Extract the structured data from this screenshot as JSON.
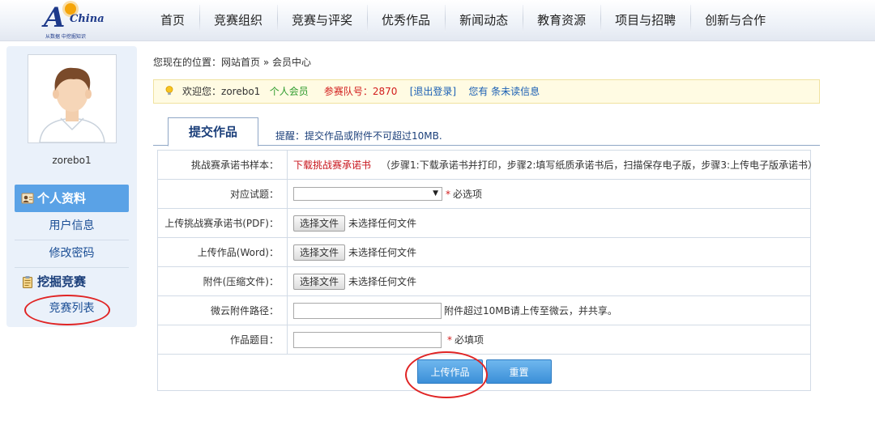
{
  "header": {
    "logo": {
      "letter": "A",
      "brand": "China",
      "tagline": "从数据   中挖掘知识"
    },
    "nav": [
      "首页",
      "竞赛组织",
      "竞赛与评奖",
      "优秀作品",
      "新闻动态",
      "教育资源",
      "项目与招聘",
      "创新与合作"
    ]
  },
  "sidebar": {
    "username": "zorebo1",
    "profile_heading": "个人资料",
    "items": [
      "用户信息",
      "修改密码"
    ],
    "contest_heading": "挖掘竞赛",
    "contest_items": [
      "竞赛列表"
    ]
  },
  "breadcrumb": {
    "prefix": "您现在的位置：",
    "home": "网站首页",
    "sep": " » ",
    "current": "会员中心"
  },
  "welcome": {
    "greeting": "欢迎您：",
    "user": "zorebo1",
    "member_type": "个人会员",
    "team_label": "参赛队号：",
    "team_id": "2870",
    "logout": "[退出登录]",
    "messages": "您有 条未读信息"
  },
  "tab": {
    "label": "提交作品",
    "tip": "提醒：提交作品或附件不可超过10MB."
  },
  "form": {
    "rows": [
      {
        "label": "挑战赛承诺书样本：",
        "link": "下载挑战赛承诺书",
        "note": "（步骤1:下载承诺书并打印，步骤2:填写纸质承诺书后，扫描保存电子版，步骤3:上传电子版承诺书）"
      },
      {
        "label": "对应试题：",
        "required_mark": "*",
        "hint": "必选项"
      },
      {
        "label": "上传挑战赛承诺书(PDF)：",
        "button": "选择文件",
        "status": "未选择任何文件"
      },
      {
        "label": "上传作品(Word)：",
        "button": "选择文件",
        "status": "未选择任何文件"
      },
      {
        "label": "附件(压缩文件)：",
        "button": "选择文件",
        "status": "未选择任何文件"
      },
      {
        "label": "微云附件路径：",
        "hint": "附件超过10MB请上传至微云，并共享。"
      },
      {
        "label": "作品题目：",
        "required_mark": "*",
        "hint": "必填项"
      }
    ],
    "submit": "上传作品",
    "reset": "重置"
  },
  "colors": {
    "accent": "#5aa2e6",
    "link_red": "#c8161d",
    "annotation_red": "#e02424"
  }
}
